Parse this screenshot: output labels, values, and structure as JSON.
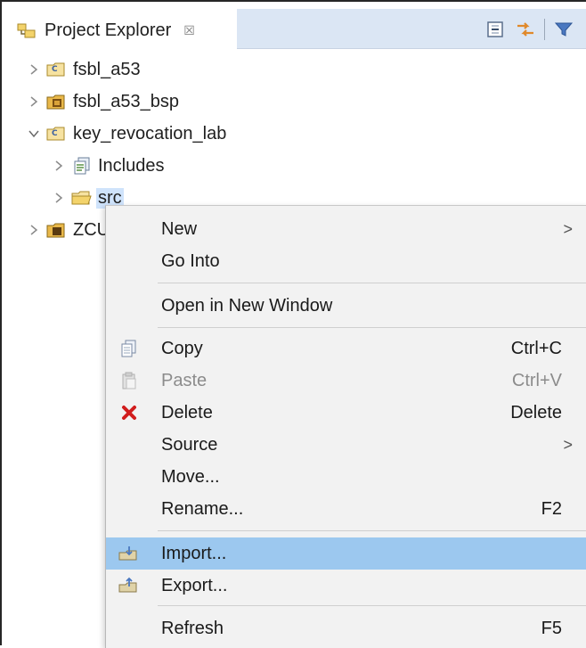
{
  "view": {
    "title": "Project Explorer",
    "close_glyph": "☒",
    "tools": [
      "collapse-all-icon",
      "link-with-editor-icon",
      "filter-icon"
    ]
  },
  "tree": {
    "items": [
      {
        "label": "fsbl_a53",
        "expanded": false,
        "icon": "c-project-folder-icon"
      },
      {
        "label": "fsbl_a53_bsp",
        "expanded": false,
        "icon": "bsp-project-icon"
      },
      {
        "label": "key_revocation_lab",
        "expanded": true,
        "icon": "c-project-folder-icon"
      },
      {
        "label": "Includes",
        "expanded": false,
        "icon": "includes-icon"
      },
      {
        "label": "src",
        "expanded": false,
        "icon": "source-folder-icon",
        "selected": true
      },
      {
        "label": "ZCU",
        "expanded": false,
        "icon": "platform-project-icon"
      }
    ]
  },
  "context_menu": {
    "items": [
      {
        "label": "New",
        "submenu": true
      },
      {
        "label": "Go Into"
      },
      {
        "label": "Open in New Window"
      },
      {
        "label": "Copy",
        "accel": "Ctrl+C",
        "icon": "copy-icon"
      },
      {
        "label": "Paste",
        "accel": "Ctrl+V",
        "icon": "paste-icon",
        "disabled": true
      },
      {
        "label": "Delete",
        "accel": "Delete",
        "icon": "delete-icon"
      },
      {
        "label": "Source",
        "submenu": true
      },
      {
        "label": "Move..."
      },
      {
        "label": "Rename...",
        "accel": "F2"
      },
      {
        "label": "Import...",
        "icon": "import-icon",
        "highlighted": true
      },
      {
        "label": "Export...",
        "icon": "export-icon"
      },
      {
        "label": "Refresh",
        "accel": "F5"
      }
    ],
    "submenu_glyph": ">"
  },
  "colors": {
    "highlight": "#9cc8ef",
    "tab_strip": "#dbe6f4",
    "menu_bg": "#f2f2f2",
    "delete_red": "#d11d1d"
  }
}
